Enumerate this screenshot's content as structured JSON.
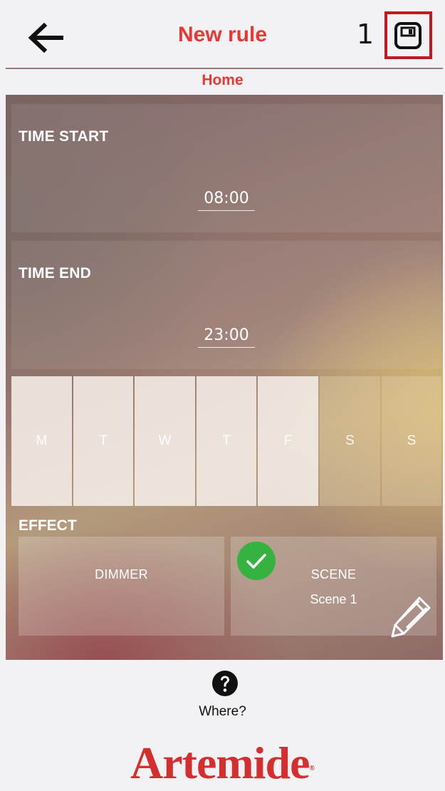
{
  "header": {
    "title": "New rule",
    "step_number": "1",
    "back_icon": "arrow-left-icon",
    "save_icon": "floppy-disk-icon",
    "highlight_color": "#c4181c"
  },
  "subtitle": "Home",
  "time_start": {
    "label": "TIME START",
    "value": "08:00"
  },
  "time_end": {
    "label": "TIME END",
    "value": "23:00"
  },
  "days": [
    {
      "label": "M",
      "selected": true
    },
    {
      "label": "T",
      "selected": true
    },
    {
      "label": "W",
      "selected": true
    },
    {
      "label": "T",
      "selected": true
    },
    {
      "label": "F",
      "selected": true
    },
    {
      "label": "S",
      "selected": false
    },
    {
      "label": "S",
      "selected": false
    }
  ],
  "effect": {
    "label": "EFFECT",
    "options": [
      {
        "name": "DIMMER",
        "selected": false
      },
      {
        "name": "SCENE",
        "detail": "Scene 1",
        "selected": true
      }
    ],
    "check_icon": "checkmark-icon",
    "edit_icon": "pencil-icon",
    "check_color": "#35b23f"
  },
  "footer": {
    "help_icon": "question-circle-icon",
    "help_text": "Where?",
    "logo_text": "Artemide",
    "logo_mark": "®"
  },
  "colors": {
    "accent": "#e53935"
  }
}
